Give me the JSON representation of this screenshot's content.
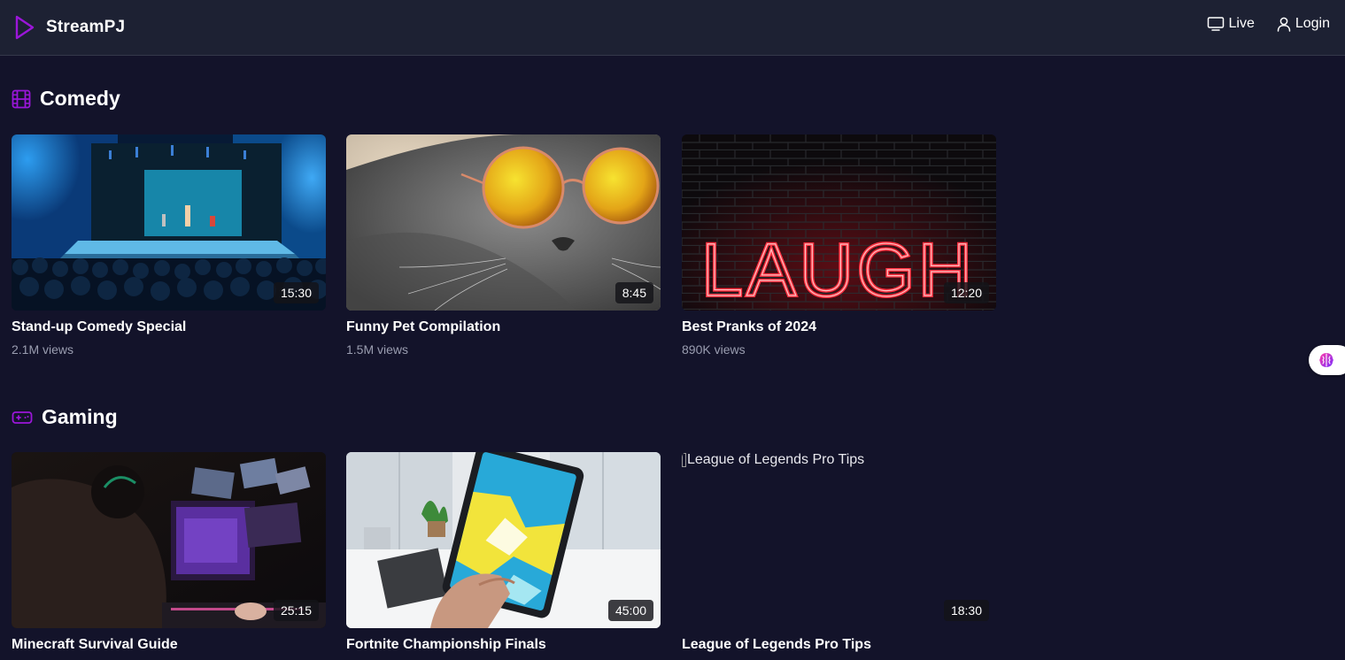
{
  "app": {
    "name": "StreamPJ",
    "brand_color": "#9b16d9"
  },
  "nav": {
    "live_label": "Live",
    "login_label": "Login"
  },
  "sections": [
    {
      "title": "Comedy",
      "icon": "film-icon",
      "videos": [
        {
          "title": "Stand-up Comedy Special",
          "duration": "15:30",
          "views": "2.1M views",
          "thumbnail": "comedy-stage-photo"
        },
        {
          "title": "Funny Pet Compilation",
          "duration": "8:45",
          "views": "1.5M views",
          "thumbnail": "cat-sunglasses-photo"
        },
        {
          "title": "Best Pranks of 2024",
          "duration": "12:20",
          "views": "890K views",
          "thumbnail": "neon-laugh-sign-photo"
        }
      ]
    },
    {
      "title": "Gaming",
      "icon": "gamepad-icon",
      "videos": [
        {
          "title": "Minecraft Survival Guide",
          "duration": "25:15",
          "thumbnail": "esports-gamer-photo"
        },
        {
          "title": "Fortnite Championship Finals",
          "duration": "45:00",
          "thumbnail": "tablet-in-hand-photo"
        },
        {
          "title": "League of Legends Pro Tips",
          "duration": "18:30",
          "thumbnail_alt": "League of Legends Pro Tips"
        }
      ]
    }
  ],
  "floating_button": {
    "icon": "brain-icon"
  },
  "neon_sign_text": "LAUGH"
}
